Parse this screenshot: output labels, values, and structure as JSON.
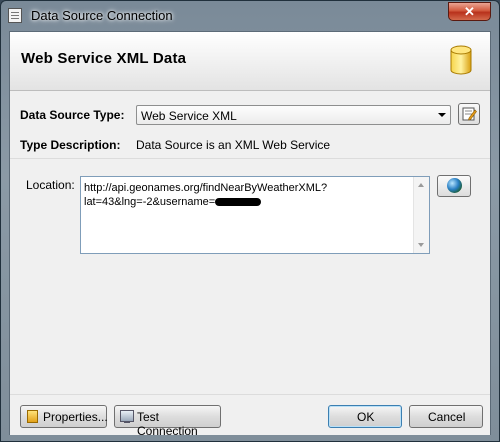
{
  "window": {
    "title": "Data Source Connection",
    "close_label": "✕"
  },
  "header": {
    "title": "Web Service XML Data",
    "icon": "database-icon"
  },
  "form": {
    "data_source_type_label": "Data Source Type:",
    "data_source_type_value": "Web Service XML",
    "type_description_label": "Type Description:",
    "type_description_value": "Data Source is an XML Web Service",
    "location_label": "Location:",
    "location_value": "http://api.geonames.org/findNearByWeatherXML?lat=43&lng=-2&username="
  },
  "footer": {
    "properties_label": "Properties...",
    "test_connection_label": "Test Connection",
    "ok_label": "OK",
    "cancel_label": "Cancel"
  },
  "colors": {
    "accent": "#3c7fb1",
    "close_button": "#c9482c",
    "header_icon": "#e8b923"
  }
}
